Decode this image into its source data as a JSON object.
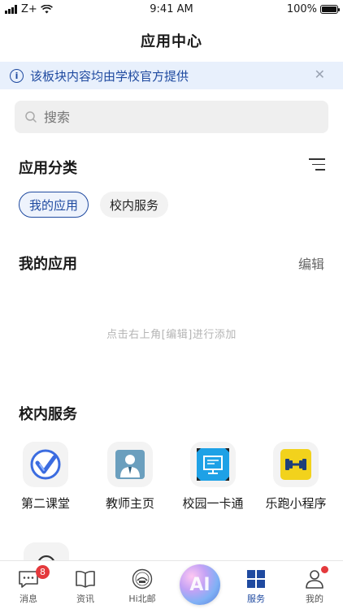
{
  "status_bar": {
    "carrier": "Z+",
    "time": "9:41 AM",
    "battery": "100%"
  },
  "header": {
    "title": "应用中心"
  },
  "notice": {
    "text": "该板块内容均由学校官方提供"
  },
  "search": {
    "placeholder": "搜索"
  },
  "categories": {
    "title": "应用分类",
    "chips": [
      {
        "label": "我的应用",
        "active": true
      },
      {
        "label": "校内服务",
        "active": false
      }
    ]
  },
  "my_apps": {
    "title": "我的应用",
    "edit_label": "编辑",
    "empty_hint": "点击右上角[编辑]进行添加"
  },
  "campus_services": {
    "title": "校内服务",
    "items": [
      {
        "label": "第二课堂",
        "icon": "second-classroom-icon",
        "color": "#3b6ce0"
      },
      {
        "label": "教师主页",
        "icon": "teacher-homepage-icon",
        "color": "#6b9fbe"
      },
      {
        "label": "校园一卡通",
        "icon": "campus-card-icon",
        "color": "#1ea1e6"
      },
      {
        "label": "乐跑小程序",
        "icon": "running-app-icon",
        "color": "#f2d21c"
      }
    ]
  },
  "tab_bar": {
    "items": [
      {
        "label": "消息",
        "icon": "message-icon",
        "badge": "8"
      },
      {
        "label": "资讯",
        "icon": "book-icon"
      },
      {
        "label": "Hi北邮",
        "icon": "school-logo-icon"
      },
      {
        "label": "AI",
        "icon": "ai-assistant-icon"
      },
      {
        "label": "服务",
        "icon": "grid-icon",
        "active": true
      },
      {
        "label": "我的",
        "icon": "profile-icon"
      }
    ]
  },
  "colors": {
    "accent": "#1f4aa0",
    "badge": "#e4393c",
    "notice_bg": "#e8f0fc"
  }
}
